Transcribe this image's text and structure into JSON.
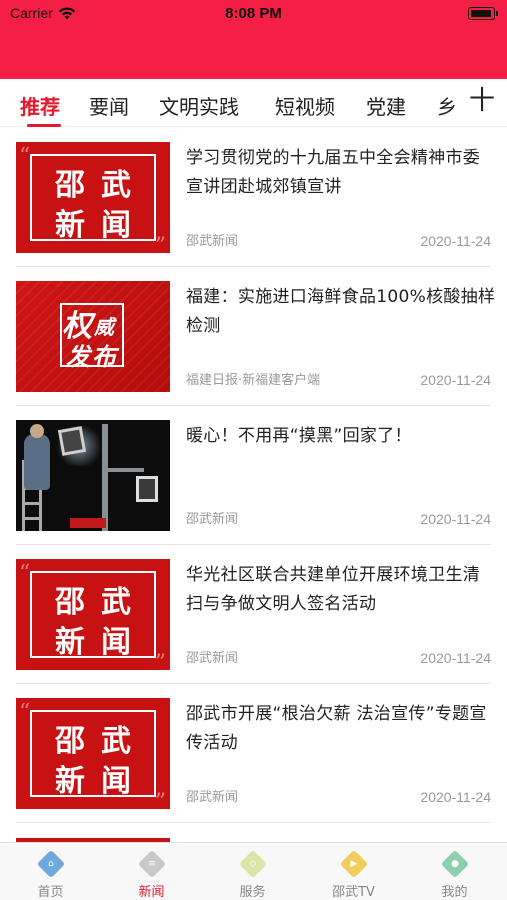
{
  "status_bar": {
    "carrier": "Carrier",
    "time": "8:08 PM"
  },
  "tabs": {
    "items": [
      {
        "label": "推荐",
        "active": true
      },
      {
        "label": "要闻",
        "active": false
      },
      {
        "label": "文明实践",
        "active": false
      },
      {
        "label": "短视频",
        "active": false
      },
      {
        "label": "党建",
        "active": false
      },
      {
        "label": "乡",
        "active": false
      }
    ],
    "add_label": "十"
  },
  "thumb_text": {
    "shaowu_line1": "邵武",
    "shaowu_line2": "新闻",
    "authority_1": "权",
    "authority_2": "威",
    "authority_3": "发布"
  },
  "news": [
    {
      "title": "学习贯彻党的十九届五中全会精神市委宣讲团赴城郊镇宣讲",
      "source": "邵武新闻",
      "date": "2020-11-24",
      "thumb": "shaowu-news"
    },
    {
      "title": "福建：实施进口海鲜食品100%核酸抽样检测",
      "source": "福建日报·新福建客户端",
      "date": "2020-11-24",
      "thumb": "authority-release"
    },
    {
      "title": "暖心！不用再“摸黑”回家了！",
      "source": "邵武新闻",
      "date": "2020-11-24",
      "thumb": "night-streetlight-photo"
    },
    {
      "title": "华光社区联合共建单位开展环境卫生清扫与争做文明人签名活动",
      "source": "邵武新闻",
      "date": "2020-11-24",
      "thumb": "shaowu-news"
    },
    {
      "title": "邵武市开展“根治欠薪 法治宣传”专题宣传活动",
      "source": "邵武新闻",
      "date": "2020-11-24",
      "thumb": "shaowu-news"
    }
  ],
  "bottom_nav": [
    {
      "label": "首页",
      "icon": "home-icon",
      "color": "#6fa8dc",
      "active": false
    },
    {
      "label": "新闻",
      "icon": "news-icon",
      "color": "#c9c9c9",
      "active": true
    },
    {
      "label": "服务",
      "icon": "service-icon",
      "color": "#d9e6a8",
      "active": false
    },
    {
      "label": "邵武TV",
      "icon": "tv-icon",
      "color": "#f2cd5c",
      "active": false
    },
    {
      "label": "我的",
      "icon": "profile-icon",
      "color": "#8fcfae",
      "active": false
    }
  ],
  "colors": {
    "header": "#f51f45",
    "accent": "#e5192e",
    "thumb_red": "#c81112"
  }
}
